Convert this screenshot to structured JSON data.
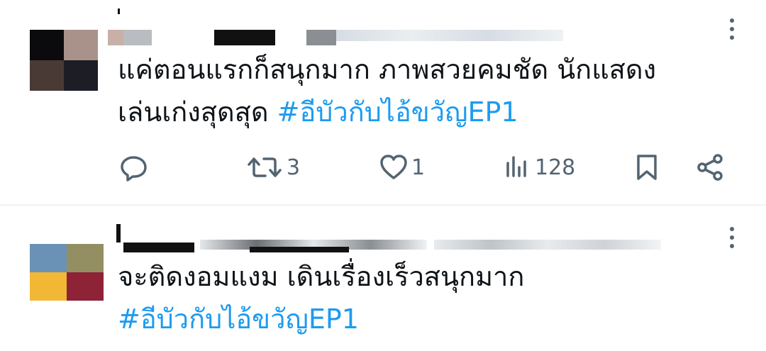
{
  "tweets": [
    {
      "text_lines": [
        "แค่ตอนแรกก็สนุกมาก ภาพสวยคมชัด นักแสดง"
      ],
      "text_line2_prefix": "เล่นเก่งสุดสุด ",
      "hashtag": "#อีบัวกับไอ้ขวัญEP1",
      "actions": {
        "retweets": "3",
        "likes": "1",
        "views": "128"
      },
      "avatar_colors": [
        "#0b0b0d",
        "#a89289",
        "#4a3a36",
        "#1c1d25"
      ]
    },
    {
      "text_line1": "จะติดงอมแงม เดินเรื่องเร็วสนุกมาก",
      "hashtag": "#อีบัวกับไอ้ขวัญEP1",
      "avatar_colors": [
        "#6a92b6",
        "#948f62",
        "#f2b835",
        "#8e2236"
      ]
    }
  ],
  "icons": {
    "reply": "reply-icon",
    "retweet": "retweet-icon",
    "like": "heart-icon",
    "views": "views-icon",
    "bookmark": "bookmark-icon",
    "share": "share-icon",
    "more": "more-icon"
  },
  "colors": {
    "hashtag": "#1d9bf0",
    "muted": "#536471",
    "text": "#0f1419",
    "divider": "#eff3f4"
  }
}
